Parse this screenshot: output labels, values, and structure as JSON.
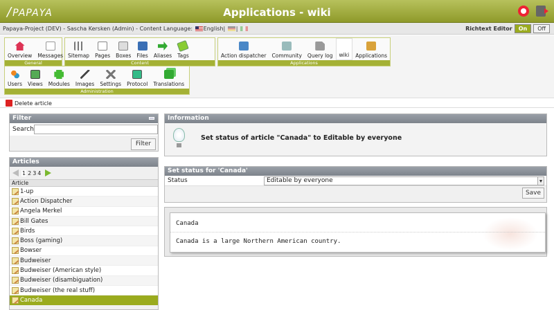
{
  "header": {
    "logo": "PAPAYA",
    "title": "Applications - wiki"
  },
  "infobar": {
    "context": "Papaya-Project (DEV) - Sascha Kersken (Admin) - Content Language:",
    "language": "English",
    "richtext_label": "Richtext Editor",
    "on_label": "On",
    "off_label": "Off"
  },
  "toolbar": {
    "general": {
      "label": "General",
      "items": [
        "Overview",
        "Messages"
      ]
    },
    "content": {
      "label": "Content",
      "items": [
        "Sitemap",
        "Pages",
        "Boxes",
        "Files",
        "Aliases",
        "Tags"
      ]
    },
    "applications": {
      "label": "Applications",
      "items": [
        "Action dispatcher",
        "Community",
        "Query log",
        "wiki",
        "Applications"
      ]
    },
    "administration": {
      "label": "Administration",
      "items": [
        "Users",
        "Views",
        "Modules",
        "Images",
        "Settings",
        "Protocol",
        "Translations"
      ]
    }
  },
  "actions": {
    "delete_label": "Delete article"
  },
  "filter": {
    "title": "Filter",
    "search_label": "Search",
    "search_value": "",
    "button": "Filter"
  },
  "articles": {
    "title": "Articles",
    "pages": [
      "1",
      "2",
      "3",
      "4"
    ],
    "column": "Article",
    "items": [
      "1-up",
      "Action Dispatcher",
      "Angela Merkel",
      "Bill Gates",
      "Birds",
      "Boss (gaming)",
      "Bowser",
      "Budweiser",
      "Budweiser (American style)",
      "Budweiser (disambiguation)",
      "Budweiser (the real stuff)",
      "Canada"
    ]
  },
  "information": {
    "title": "Information",
    "message": "Set status of article \"Canada\" to Editable by everyone"
  },
  "status_form": {
    "title": "Set status for 'Canada'",
    "label": "Status",
    "value": "Editable by everyone",
    "save": "Save"
  },
  "preview": {
    "title": "Canada",
    "text": "Canada is a large Northern American country."
  },
  "colors": {
    "accent": "#9aab1e",
    "header": "#a4b135",
    "panel_header": "#8a9098"
  }
}
